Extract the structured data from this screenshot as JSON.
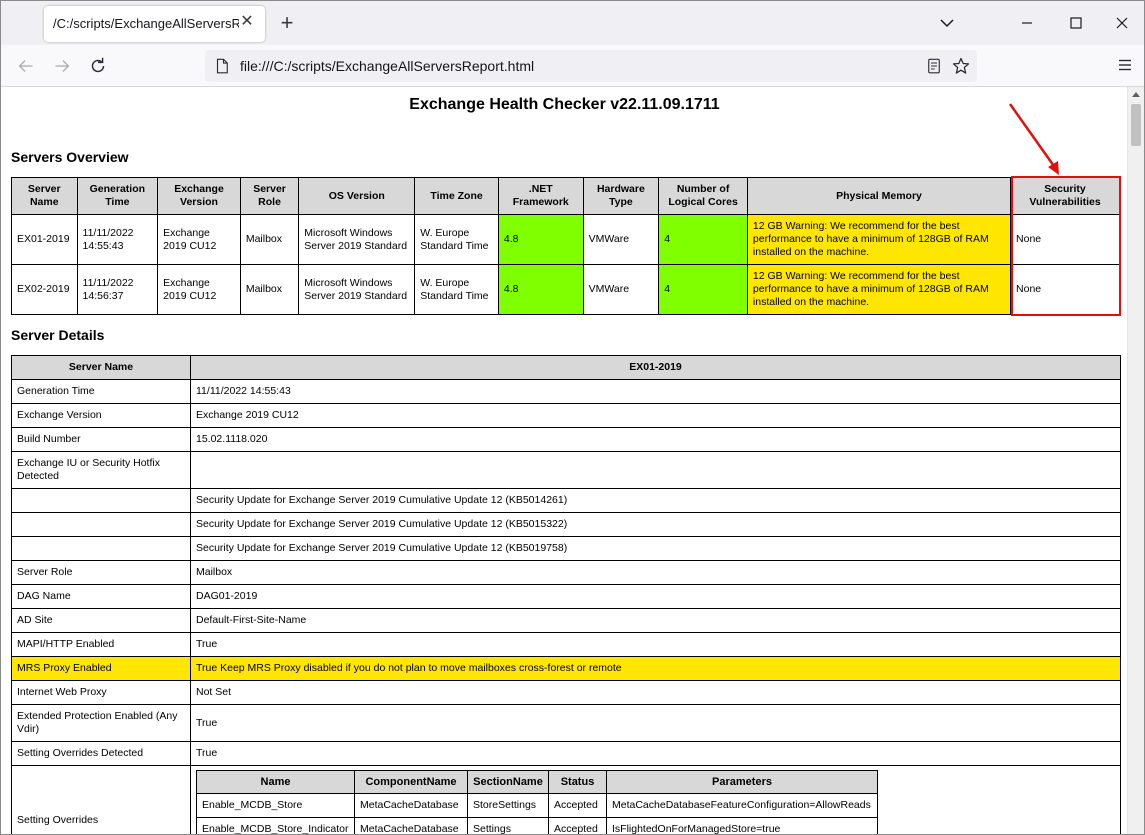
{
  "browser": {
    "tab_title": "/C:/scripts/ExchangeAllServersRepor",
    "tab_close": "✕",
    "new_tab": "+",
    "url": "file:///C:/scripts/ExchangeAllServersReport.html",
    "icons": [
      "back-icon",
      "forward-icon",
      "reload-icon",
      "reader-view-icon",
      "bookmark-star-icon",
      "menu-icon"
    ]
  },
  "report": {
    "title": "Exchange Health Checker v22.11.09.1711",
    "overview_title": "Servers Overview",
    "details_title": "Server Details"
  },
  "overview": {
    "headers": [
      "Server Name",
      "Generation Time",
      "Exchange Version",
      "Server Role",
      "OS Version",
      "Time Zone",
      ".NET Framework",
      "Hardware Type",
      "Number of Logical Cores",
      "Physical Memory",
      "Security Vulnerabilities"
    ],
    "rows": [
      {
        "server_name": "EX01-2019",
        "generation_time": "11/11/2022 14:55:43",
        "exchange_version": "Exchange 2019 CU12",
        "server_role": "Mailbox",
        "os_version": "Microsoft Windows Server 2019 Standard",
        "time_zone": "W. Europe Standard Time",
        "net_framework": "4.8",
        "hardware_type": "VMWare",
        "logical_cores": "4",
        "physical_memory": "12 GB Warning: We recommend for the best performance to have a minimum of 128GB of RAM installed on the machine.",
        "security_vulnerabilities": "None"
      },
      {
        "server_name": "EX02-2019",
        "generation_time": "11/11/2022 14:56:37",
        "exchange_version": "Exchange 2019 CU12",
        "server_role": "Mailbox",
        "os_version": "Microsoft Windows Server 2019 Standard",
        "time_zone": "W. Europe Standard Time",
        "net_framework": "4.8",
        "hardware_type": "VMWare",
        "logical_cores": "4",
        "physical_memory": "12 GB Warning: We recommend for the best performance to have a minimum of 128GB of RAM installed on the machine.",
        "security_vulnerabilities": "None"
      }
    ]
  },
  "details": {
    "header_label": "Server Name",
    "header_value": "EX01-2019",
    "rows": [
      {
        "label": "Generation Time",
        "value": "11/11/2022 14:55:43"
      },
      {
        "label": "Exchange Version",
        "value": "Exchange 2019 CU12"
      },
      {
        "label": "Build Number",
        "value": "15.02.1118.020"
      },
      {
        "label": "Exchange IU or Security Hotfix Detected",
        "value": ""
      },
      {
        "label": "",
        "value": "Security Update for Exchange Server 2019 Cumulative Update 12 (KB5014261)"
      },
      {
        "label": "",
        "value": "Security Update for Exchange Server 2019 Cumulative Update 12 (KB5015322)"
      },
      {
        "label": "",
        "value": "Security Update for Exchange Server 2019 Cumulative Update 12 (KB5019758)"
      },
      {
        "label": "Server Role",
        "value": "Mailbox"
      },
      {
        "label": "DAG Name",
        "value": "DAG01-2019"
      },
      {
        "label": "AD Site",
        "value": "Default-First-Site-Name"
      },
      {
        "label": "MAPI/HTTP Enabled",
        "value": "True"
      },
      {
        "label": "MRS Proxy Enabled",
        "value": "True Keep MRS Proxy disabled if you do not plan to move mailboxes cross-forest or remote",
        "status": "warning"
      },
      {
        "label": "Internet Web Proxy",
        "value": "Not Set"
      },
      {
        "label": "Extended Protection Enabled (Any Vdir)",
        "value": "True"
      },
      {
        "label": "Setting Overrides Detected",
        "value": "True"
      }
    ],
    "overrides_label": "Setting Overrides",
    "overrides": {
      "headers": [
        "Name",
        "ComponentName",
        "SectionName",
        "Status",
        "Parameters"
      ],
      "rows": [
        {
          "name": "Enable_MCDB_Store",
          "component": "MetaCacheDatabase",
          "section": "StoreSettings",
          "status": "Accepted",
          "parameters": "MetaCacheDatabaseFeatureConfiguration=AllowReads"
        },
        {
          "name": "Enable_MCDB_Store_Indicator",
          "component": "MetaCacheDatabase",
          "section": "Settings",
          "status": "Accepted",
          "parameters": "IsFlightedOnForManagedStore=true"
        }
      ]
    }
  },
  "colors": {
    "ok": "#7fff00",
    "warning": "#ffe600",
    "annotation": "#e01010",
    "header_bg": "#d8d8d8"
  }
}
